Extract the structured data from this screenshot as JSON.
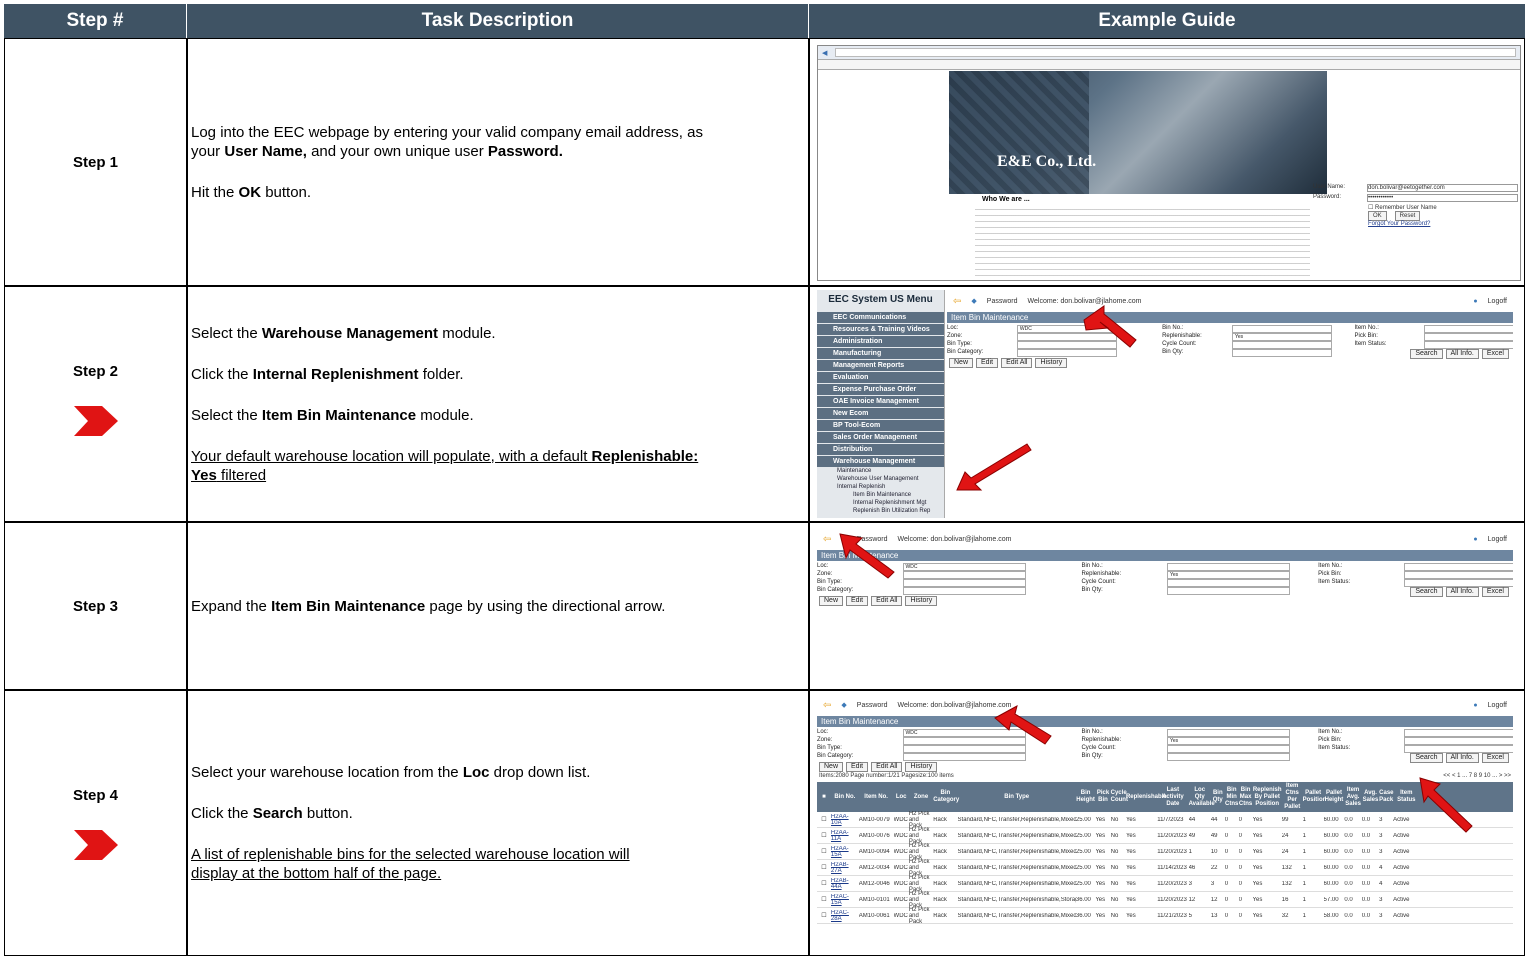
{
  "headers": {
    "step": "Step #",
    "task": "Task Description",
    "guide": "Example Guide"
  },
  "rows": [
    {
      "step": "Step 1",
      "lines": [
        [
          "Log into the EEC webpage by entering your valid company email address, as"
        ],
        [
          "your ",
          {
            "b": "User Name,"
          },
          " and your own unique user ",
          {
            "b": "Password."
          }
        ],
        [],
        [
          "Hit the ",
          {
            "b": "OK"
          },
          " button."
        ]
      ]
    },
    {
      "step": "Step 2",
      "lines": [
        [
          "Select the ",
          {
            "b": "Warehouse Management"
          },
          " module."
        ],
        [],
        [
          "Click the ",
          {
            "b": "Internal Replenishment"
          },
          " folder."
        ],
        [],
        [
          "Select the ",
          {
            "b": "Item Bin Maintenance"
          },
          " module."
        ],
        [],
        [
          {
            "u": "Your default warehouse location will populate, with a default "
          },
          {
            "ub": "Replenishable:"
          }
        ],
        [
          {
            "ub": "Yes"
          },
          {
            "u": " filtered"
          }
        ]
      ]
    },
    {
      "step": "Step 3",
      "lines": [
        [
          "Expand the ",
          {
            "b": "Item Bin Maintenance"
          },
          " page by using the directional arrow."
        ]
      ]
    },
    {
      "step": "Step 4",
      "lines": [
        [
          "Select your warehouse location from the ",
          {
            "b": "Loc"
          },
          " drop down list."
        ],
        [],
        [
          "Click the ",
          {
            "b": "Search"
          },
          " button."
        ],
        [],
        [
          {
            "u": "A list of replenishable bins for the selected warehouse location will"
          }
        ],
        [
          {
            "u": "display at the bottom half of the page."
          }
        ]
      ]
    }
  ],
  "shot1": {
    "company": "E&E Co., Ltd.",
    "who": "Who We are ...",
    "user_label": "User Name:",
    "pass_label": "Password:",
    "user_value": "don.bolivar@eetogether.com",
    "pass_value": "••••••••••••",
    "remember": "Remember User Name",
    "ok": "OK",
    "reset": "Reset",
    "forgot": "Forgot Your Password?"
  },
  "app": {
    "password": "Password",
    "welcome": "Welcome: don.bolivar@jlahome.com",
    "logoff": "Logoff",
    "title": "Item Bin Maintenance",
    "loc": "Loc:",
    "loc_value": "WDC",
    "zone": "Zone:",
    "bin_type": "Bin Type:",
    "bin_category": "Bin Category:",
    "bin_no": "Bin No.:",
    "replenishable": "Replenishable:",
    "repl_value": "Yes",
    "cycle_count": "Cycle Count:",
    "bin_qty": "Bin Qty:",
    "item_no": "Item No.:",
    "pick_bin": "Pick Bin:",
    "item_status": "Item Status:",
    "search": "Search",
    "all_info": "All Info.",
    "excel": "Excel",
    "new": "New",
    "edit": "Edit",
    "edit_all": "Edit All",
    "history": "History"
  },
  "menu": {
    "title": "EEC System US Menu",
    "items": [
      "EEC Communications",
      "Resources & Training Videos",
      "Administration",
      "Manufacturing",
      "Management Reports",
      "Evaluation",
      "Expense Purchase Order",
      "OAE Invoice Management",
      "New Ecom",
      "BP Tool-Ecom",
      "Sales Order Management",
      "Distribution",
      "Warehouse Management"
    ],
    "sub": [
      "Maintenance",
      "Warehouse User Management",
      "Internal Replenish"
    ],
    "leaf": [
      "Item Bin Maintenance",
      "Internal Replenishment Mgt",
      "Replenish Bin Utilization Rep"
    ]
  },
  "grid": {
    "info": "Items:2080   Page number:1/21   Pagesize:100 items",
    "pager": "<< < 1 ... 7 8 9 10 ... > >>",
    "cols": [
      "Bin No.",
      "Item No.",
      "Loc",
      "Zone",
      "Bin Category",
      "Bin Type",
      "Bin Height",
      "Pick Bin",
      "Cycle Count",
      "Replenishable",
      "Last Activity Date",
      "Loc Qty Available",
      "Bin Qty",
      "Bin Min Ctns",
      "Bin Max Ctns",
      "Replenish By Pallet Position",
      "Item Ctns Per Pallet",
      "Pallet Position",
      "Pallet Height",
      "Item Avg. Sales",
      "Avg. Sales",
      "Case Pack",
      "Item Status"
    ],
    "rows": [
      [
        "H2AA-10A",
        "AM10-0079",
        "WDC",
        "H2 Pick and Pack",
        "Rack",
        "Standard,NFC,Transfer,Replenishable,Mixed,Storage",
        "25.00",
        "Yes",
        "No",
        "Yes",
        "11/7/2023",
        "44",
        "44",
        "0",
        "0",
        "Yes",
        "99",
        "1",
        "60.00",
        "0.0",
        "0.0",
        "3",
        "Active"
      ],
      [
        "H2AA-11A",
        "AM10-0076",
        "WDC",
        "H2 Pick and Pack",
        "Rack",
        "Standard,NFC,Transfer,Replenishable,Mixed,Storage",
        "25.00",
        "Yes",
        "No",
        "Yes",
        "11/20/2023",
        "49",
        "49",
        "0",
        "0",
        "Yes",
        "24",
        "1",
        "60.00",
        "0.0",
        "0.0",
        "3",
        "Active"
      ],
      [
        "H2AA-15A",
        "AM10-0094",
        "WDC",
        "H2 Pick and Pack",
        "Rack",
        "Standard,NFC,Transfer,Replenishable,Mixed,Storage",
        "25.00",
        "Yes",
        "No",
        "Yes",
        "11/20/2023",
        "1",
        "10",
        "0",
        "0",
        "Yes",
        "24",
        "1",
        "60.00",
        "0.0",
        "0.0",
        "3",
        "Active"
      ],
      [
        "H2AB-27A",
        "AM12-0034",
        "WDC",
        "H2 Pick and Pack",
        "Rack",
        "Standard,NFC,Transfer,Replenishable,Mixed,Storage",
        "25.00",
        "Yes",
        "No",
        "Yes",
        "11/14/2023",
        "46",
        "22",
        "0",
        "0",
        "Yes",
        "132",
        "1",
        "60.00",
        "0.0",
        "0.0",
        "4",
        "Active"
      ],
      [
        "H2AB-44A",
        "AM12-0046",
        "WDC",
        "H2 Pick and Pack",
        "Rack",
        "Standard,NFC,Transfer,Replenishable,Mixed,Storage",
        "25.00",
        "Yes",
        "No",
        "Yes",
        "11/20/2023",
        "3",
        "3",
        "0",
        "0",
        "Yes",
        "132",
        "1",
        "60.00",
        "0.0",
        "0.0",
        "4",
        "Active"
      ],
      [
        "H2AC-15A",
        "AM10-0101",
        "WDC",
        "H2 Pick and Pack",
        "Rack",
        "Standard,NFC,Transfer,Replenishable,Storage",
        "36.00",
        "Yes",
        "No",
        "Yes",
        "11/20/2023",
        "12",
        "12",
        "0",
        "0",
        "Yes",
        "16",
        "1",
        "57.00",
        "0.0",
        "0.0",
        "3",
        "Active"
      ],
      [
        "H2AC-28A",
        "AM10-0061",
        "WDC",
        "H2 Pick and Pack",
        "Rack",
        "Standard,NFC,Transfer,Replenishable,Mixed,Storage",
        "36.00",
        "Yes",
        "No",
        "Yes",
        "11/21/2023",
        "5",
        "13",
        "0",
        "0",
        "Yes",
        "32",
        "1",
        "58.00",
        "0.0",
        "0.0",
        "3",
        "Active"
      ]
    ]
  }
}
